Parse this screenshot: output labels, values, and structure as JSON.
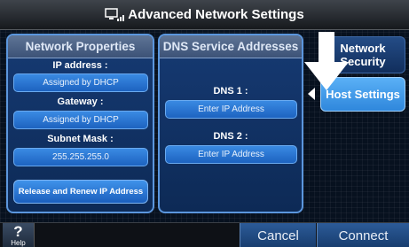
{
  "title": "Advanced Network Settings",
  "colors": {
    "accent": "#5b96dd",
    "field": "#2a76d3",
    "selected_tab": "#4a9ff0",
    "bottom_button": "#214b82"
  },
  "network_properties": {
    "header": "Network Properties",
    "ip_label": "IP address :",
    "ip_value": "Assigned by DHCP",
    "gateway_label": "Gateway :",
    "gateway_value": "Assigned by DHCP",
    "subnet_label": "Subnet Mask :",
    "subnet_value": "255.255.255.0",
    "release_button": "Release and Renew IP Address"
  },
  "dns": {
    "header": "DNS Service Addresses",
    "dns1_label": "DNS 1 :",
    "dns1_placeholder": "Enter IP Address",
    "dns2_label": "DNS 2 :",
    "dns2_placeholder": "Enter IP Address"
  },
  "side_tabs": {
    "network_security": "Network Security",
    "host_settings": "Host Settings",
    "selected": "Host Settings"
  },
  "bottom": {
    "help_symbol": "?",
    "help_label": "Help",
    "cancel": "Cancel",
    "connect": "Connect"
  },
  "icons": [
    "network-icon",
    "down-arrow-pointer-icon",
    "tab-selector-arrow-icon",
    "help-icon"
  ]
}
